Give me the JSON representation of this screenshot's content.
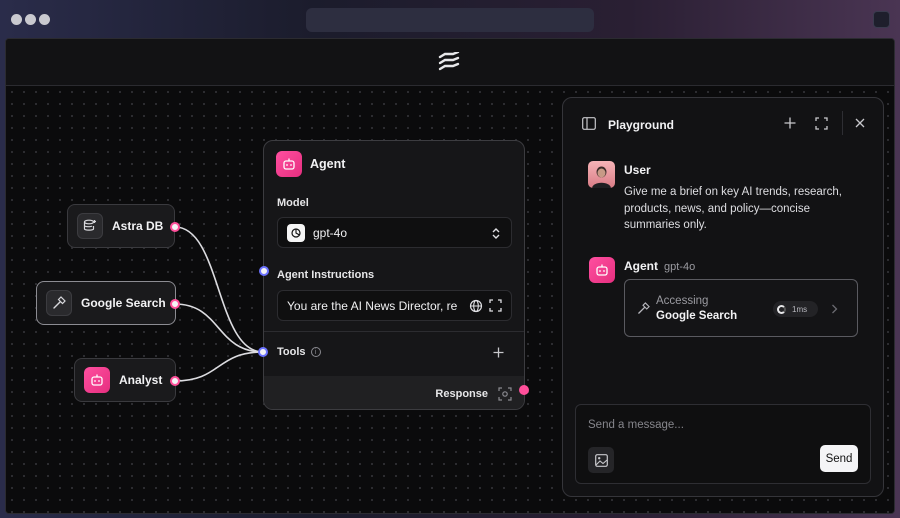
{
  "colors": {
    "accent_pink": "#ff4f9a",
    "accent_blue": "#6b72ff",
    "background": "#0a0a0b"
  },
  "canvas": {
    "tools": [
      {
        "label": "Astra DB",
        "icon": "database-plus-icon"
      },
      {
        "label": "Google Search",
        "icon": "hammer-icon"
      },
      {
        "label": "Analyst",
        "icon": "bot-icon"
      }
    ],
    "agent": {
      "title": "Agent",
      "model_label": "Model",
      "model_value": "gpt-4o",
      "instructions_label": "Agent Instructions",
      "instructions_value": "You are the AI News Director, re",
      "tools_label": "Tools",
      "response_label": "Response"
    }
  },
  "playground": {
    "title": "Playground",
    "user": {
      "name": "User",
      "message": "Give me a brief on key AI trends, research, products, news, and policy—concise summaries only."
    },
    "agent": {
      "name": "Agent",
      "model": "gpt-4o",
      "status_line1": "Accessing",
      "status_line2": "Google Search",
      "timer": "1ms"
    },
    "input": {
      "placeholder": "Send a message...",
      "send_label": "Send"
    }
  }
}
